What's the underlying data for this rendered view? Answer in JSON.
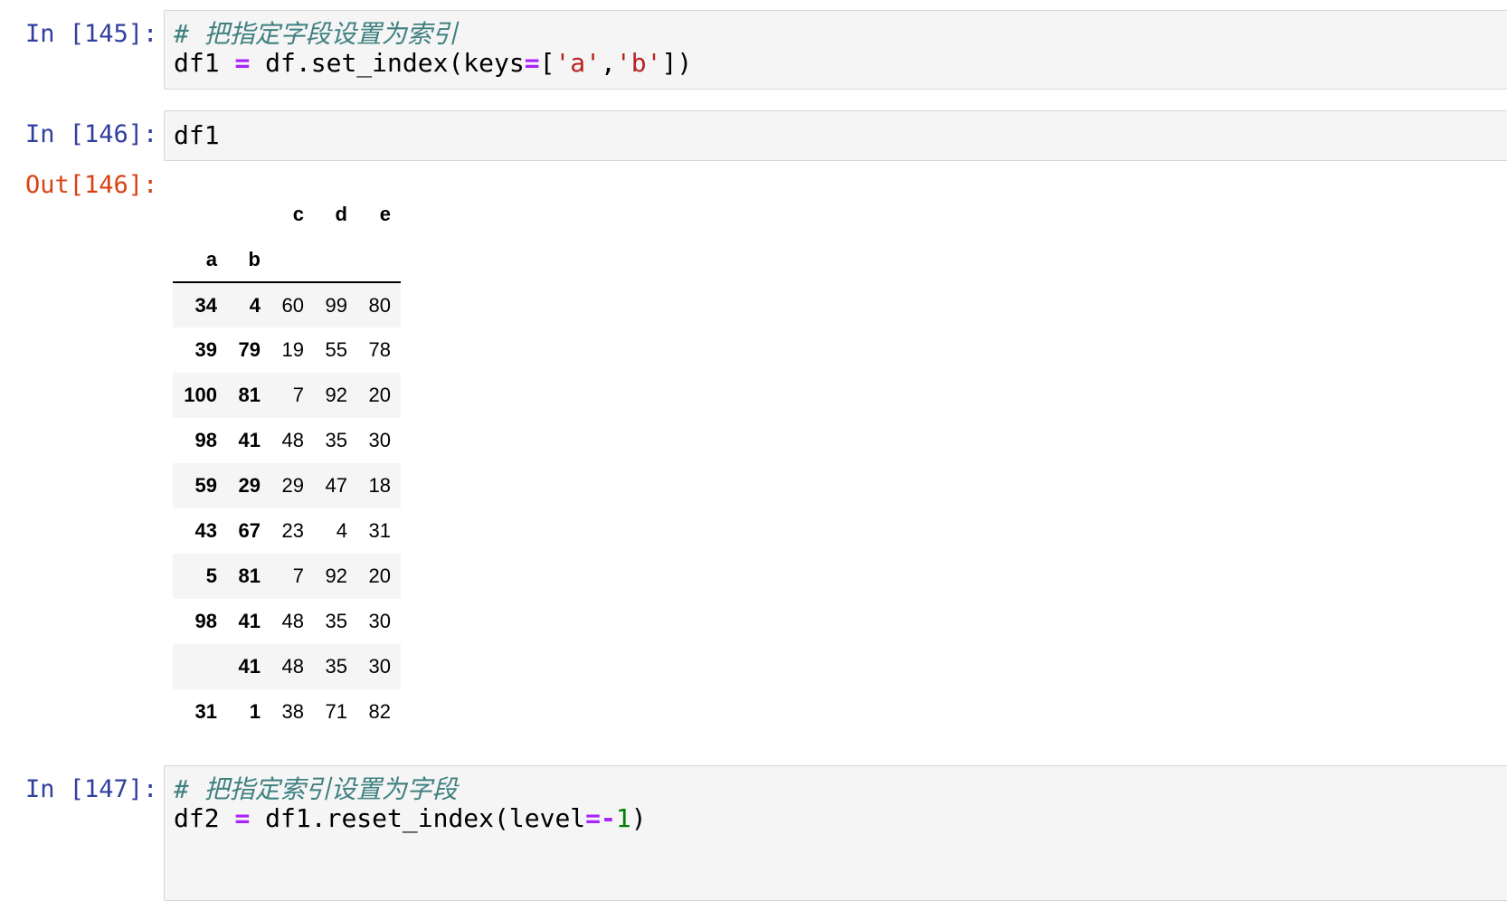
{
  "cells": [
    {
      "prompt": "In [145]:",
      "code": {
        "comment": "# 把指定字段设置为索引",
        "line2": {
          "var": "df1",
          "op": "=",
          "call": "df.set_index(keys",
          "eq": "=",
          "lb": "[",
          "s1": "'a'",
          "comma": ",",
          "s2": "'b'",
          "rb": "])"
        }
      }
    },
    {
      "prompt": "In [146]:",
      "code": {
        "line1": "df1"
      },
      "out_prompt": "Out[146]:"
    },
    {
      "prompt": "In [147]:",
      "code": {
        "comment": "# 把指定索引设置为字段",
        "line2": {
          "var": "df2",
          "op": "=",
          "call": "df1.reset_index(level",
          "eq": "=",
          "neg": "-",
          "num": "1",
          "close": ")"
        }
      }
    }
  ],
  "dataframe": {
    "columns": [
      "c",
      "d",
      "e"
    ],
    "index_names": [
      "a",
      "b"
    ],
    "rows": [
      {
        "a": "34",
        "b": "4",
        "values": [
          "60",
          "99",
          "80"
        ]
      },
      {
        "a": "39",
        "b": "79",
        "values": [
          "19",
          "55",
          "78"
        ]
      },
      {
        "a": "100",
        "b": "81",
        "values": [
          "7",
          "92",
          "20"
        ]
      },
      {
        "a": "98",
        "b": "41",
        "values": [
          "48",
          "35",
          "30"
        ]
      },
      {
        "a": "59",
        "b": "29",
        "values": [
          "29",
          "47",
          "18"
        ]
      },
      {
        "a": "43",
        "b": "67",
        "values": [
          "23",
          "4",
          "31"
        ]
      },
      {
        "a": "5",
        "b": "81",
        "values": [
          "7",
          "92",
          "20"
        ]
      },
      {
        "a": "98",
        "b": "41",
        "values": [
          "48",
          "35",
          "30"
        ]
      },
      {
        "a": "",
        "b": "41",
        "values": [
          "48",
          "35",
          "30"
        ]
      },
      {
        "a": "31",
        "b": "1",
        "values": [
          "38",
          "71",
          "82"
        ]
      }
    ]
  },
  "colors": {
    "in_prompt": "#303f9f",
    "out_prompt": "#d84315",
    "comment": "#408080",
    "operator": "#aa22ff",
    "string": "#ba2121",
    "number": "#008000",
    "row_shade": "#f5f5f5"
  }
}
